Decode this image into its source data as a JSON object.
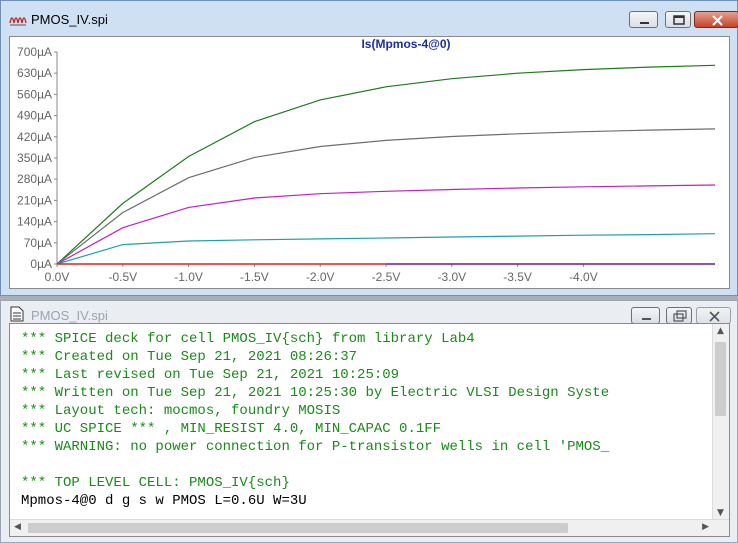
{
  "waveform_window": {
    "title": "PMOS_IV.spi",
    "icon": "waveform-icon",
    "buttons": {
      "minimize": "minimize-icon",
      "maximize": "maximize-icon",
      "close": "close-icon"
    }
  },
  "netlist_window": {
    "title": "PMOS_IV.spi",
    "icon": "document-icon",
    "lines": [
      {
        "text": "*** SPICE deck for cell PMOS_IV{sch} from library Lab4",
        "color": "#1a8a1a"
      },
      {
        "text": "*** Created on Tue Sep 21, 2021 08:26:37",
        "color": "#1a8a1a"
      },
      {
        "text": "*** Last revised on Tue Sep 21, 2021 10:25:09",
        "color": "#1a8a1a"
      },
      {
        "text": "*** Written on Tue Sep 21, 2021 10:25:30 by Electric VLSI Design Syste",
        "color": "#1a8a1a"
      },
      {
        "text": "*** Layout tech: mocmos, foundry MOSIS",
        "color": "#1a8a1a"
      },
      {
        "text": "*** UC SPICE *** , MIN_RESIST 4.0, MIN_CAPAC 0.1FF",
        "color": "#1a8a1a"
      },
      {
        "text": "*** WARNING: no power connection for P-transistor wells in cell 'PMOS_",
        "color": "#1a8a1a"
      },
      {
        "text": "",
        "color": "#1a8a1a"
      },
      {
        "text": "*** TOP LEVEL CELL: PMOS_IV{sch}",
        "color": "#1a8a1a"
      },
      {
        "text": "Mpmos-4@0 d g s w PMOS L=0.6U W=3U",
        "color": "#000000"
      }
    ]
  },
  "chart_data": {
    "type": "line",
    "title": "Is(Mpmos-4@0)",
    "x_ticks": [
      "0.0V",
      "-0.5V",
      "-1.0V",
      "-1.5V",
      "-2.0V",
      "-2.5V",
      "-3.0V",
      "-3.5V",
      "-4.0V"
    ],
    "y_ticks": [
      "0µA",
      "70µA",
      "140µA",
      "210µA",
      "280µA",
      "350µA",
      "420µA",
      "490µA",
      "560µA",
      "630µA",
      "700µA"
    ],
    "xlim": [
      0,
      -5
    ],
    "ylim": [
      0,
      700
    ],
    "grid": false,
    "series": [
      {
        "color": "#1f7a1f",
        "x": [
          0,
          -0.5,
          -1.0,
          -1.5,
          -2.0,
          -2.5,
          -3.0,
          -3.5,
          -4.0,
          -4.5,
          -5.0
        ],
        "y": [
          0,
          200,
          355,
          470,
          542,
          585,
          612,
          630,
          642,
          650,
          656
        ]
      },
      {
        "color": "#6d6d6d",
        "x": [
          0,
          -0.5,
          -1.0,
          -1.5,
          -2.0,
          -2.5,
          -3.0,
          -3.5,
          -4.0,
          -4.5,
          -5.0
        ],
        "y": [
          0,
          170,
          285,
          352,
          388,
          408,
          421,
          430,
          437,
          442,
          446
        ]
      },
      {
        "color": "#c021c0",
        "x": [
          0,
          -0.5,
          -1.0,
          -1.5,
          -2.0,
          -2.5,
          -3.0,
          -3.5,
          -4.0,
          -4.5,
          -5.0
        ],
        "y": [
          0,
          120,
          187,
          218,
          232,
          240,
          246,
          251,
          255,
          258,
          261
        ]
      },
      {
        "color": "#1fa0a8",
        "x": [
          0,
          -0.5,
          -1.0,
          -1.5,
          -2.0,
          -2.5,
          -3.0,
          -3.5,
          -4.0,
          -4.5,
          -5.0
        ],
        "y": [
          0,
          64,
          76,
          80,
          83,
          86,
          89,
          92,
          95,
          97,
          100
        ]
      },
      {
        "color": "#e02020",
        "x": [
          0,
          -2.5
        ],
        "y": [
          0,
          0
        ]
      },
      {
        "color": "#6a1b9a",
        "x": [
          -2.5,
          -5.0
        ],
        "y": [
          0,
          0
        ]
      }
    ]
  }
}
